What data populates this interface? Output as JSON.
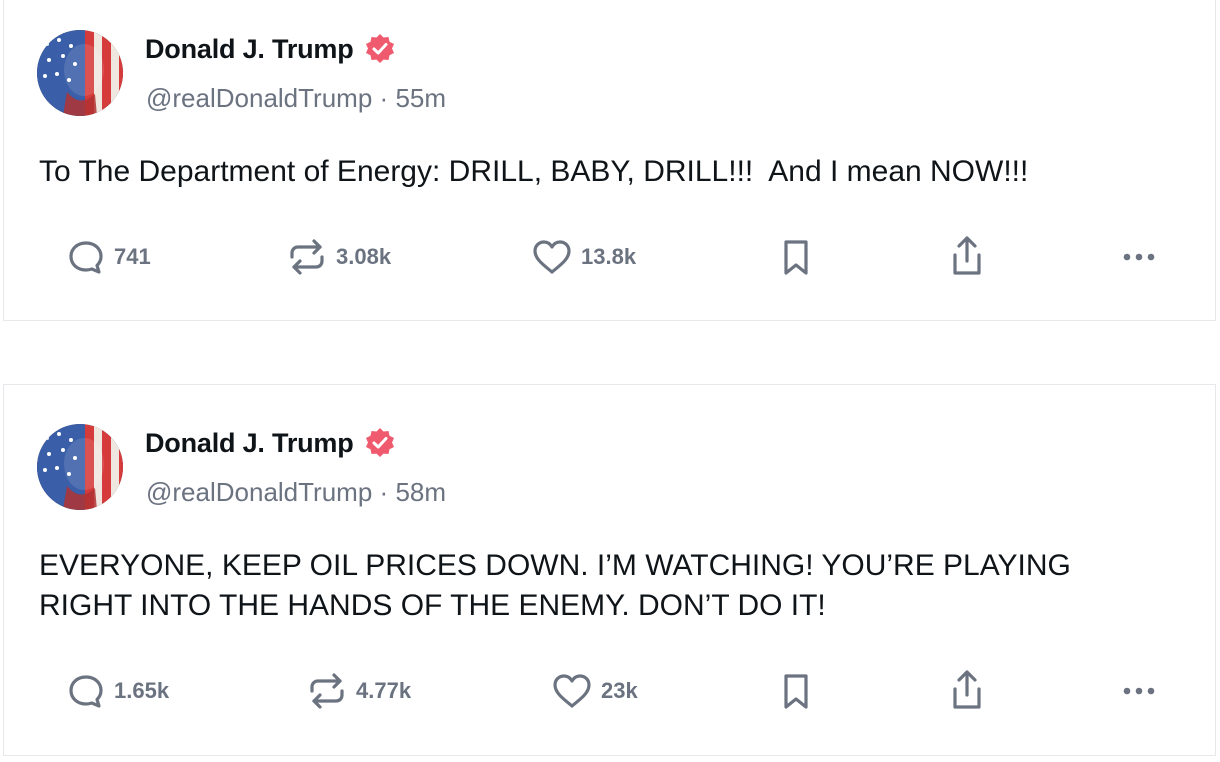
{
  "posts": [
    {
      "author_name": "Donald J. Trump",
      "handle": "@realDonaldTrump",
      "separator": "·",
      "time": "55m",
      "text": "To The Department of Energy: DRILL, BABY, DRILL!!!  And I mean NOW!!!",
      "replies": "741",
      "reposts": "3.08k",
      "likes": "13.8k"
    },
    {
      "author_name": "Donald J. Trump",
      "handle": "@realDonaldTrump",
      "separator": "·",
      "time": "58m",
      "text": "EVERYONE, KEEP OIL PRICES DOWN. I’M WATCHING! YOU’RE PLAYING RIGHT INTO THE HANDS OF THE ENEMY. DON’T DO IT!",
      "replies": "1.65k",
      "reposts": "4.77k",
      "likes": "23k"
    }
  ],
  "icons": {
    "reply": "reply-icon",
    "repost": "repost-icon",
    "like": "heart-icon",
    "bookmark": "bookmark-icon",
    "share": "share-icon",
    "more": "more-icon",
    "verified": "verified-badge-icon"
  },
  "colors": {
    "verified": "#ef5a6f",
    "muted": "#6b7280",
    "text": "#0f1419"
  }
}
